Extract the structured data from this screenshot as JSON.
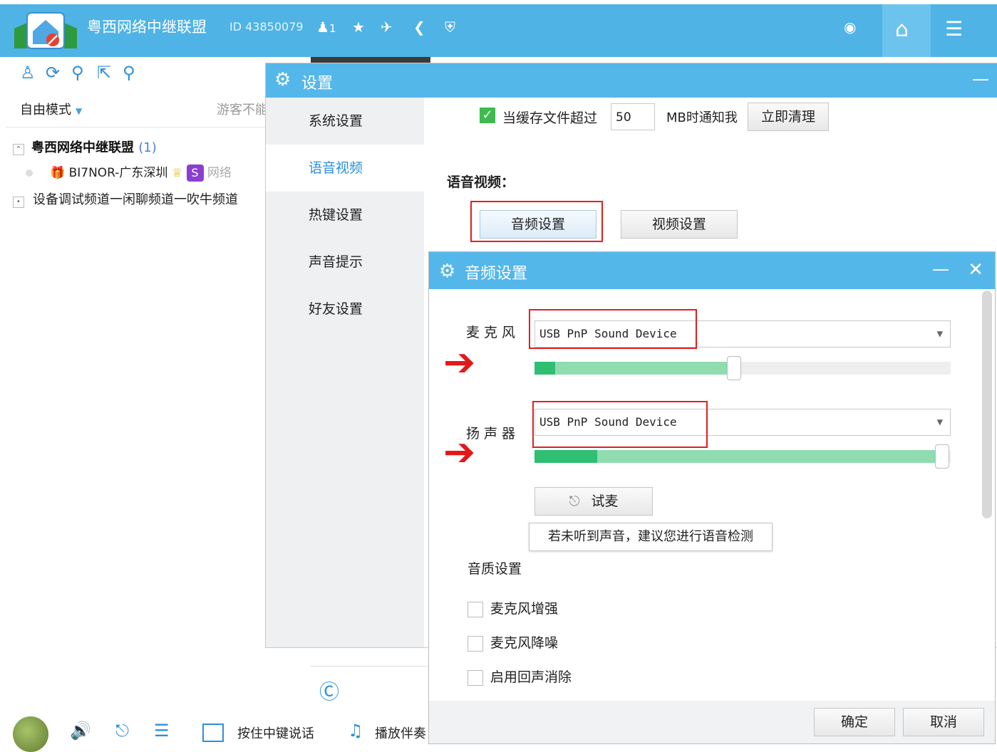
{
  "app": {
    "title": "粤西网络中继联盟",
    "id_label": "ID 43850079",
    "user_count": "1"
  },
  "left": {
    "mode": "自由模式",
    "guest_text": "游客不能",
    "channel_root": "粤西网络中继联盟",
    "channel_root_count": "(1)",
    "user_name": "BI7NOR-广东深圳",
    "user_extra": "网络",
    "channel_sub": "设备调试频道一闲聊频道一吹牛频道"
  },
  "bottom": {
    "ptt_label": "按住中键说话",
    "music_label": "播放伴奏"
  },
  "settings": {
    "title": "设置",
    "nav": [
      "系统设置",
      "语音视频",
      "热键设置",
      "声音提示",
      "好友设置"
    ],
    "active_nav": "语音视频",
    "cache_label": "当缓存文件超过",
    "cache_value": "50",
    "cache_unit": "MB时通知我",
    "clear_button": "立即清理",
    "av_heading": "语音视频：",
    "audio_button": "音频设置",
    "video_button": "视频设置"
  },
  "audio": {
    "title": "音频设置",
    "mic_label": "麦克风",
    "mic_device": "USB PnP Sound Device",
    "mic_level": 0.05,
    "mic_volume": 0.48,
    "speaker_label": "扬声器",
    "speaker_device": "USB PnP Sound Device",
    "speaker_level": 0.15,
    "speaker_volume": 0.98,
    "test_button": "试麦",
    "tip": "若未听到声音，建议您进行语音检测",
    "quality_heading": "音质设置",
    "options": [
      "麦克风增强",
      "麦克风降噪",
      "启用回声消除"
    ],
    "ok_button": "确定",
    "cancel_button": "取消"
  },
  "colors": {
    "titlebar": "#54b7ea",
    "accent": "#2f8fd8",
    "highlight": "#e02020",
    "slider": "#2fbf72"
  }
}
